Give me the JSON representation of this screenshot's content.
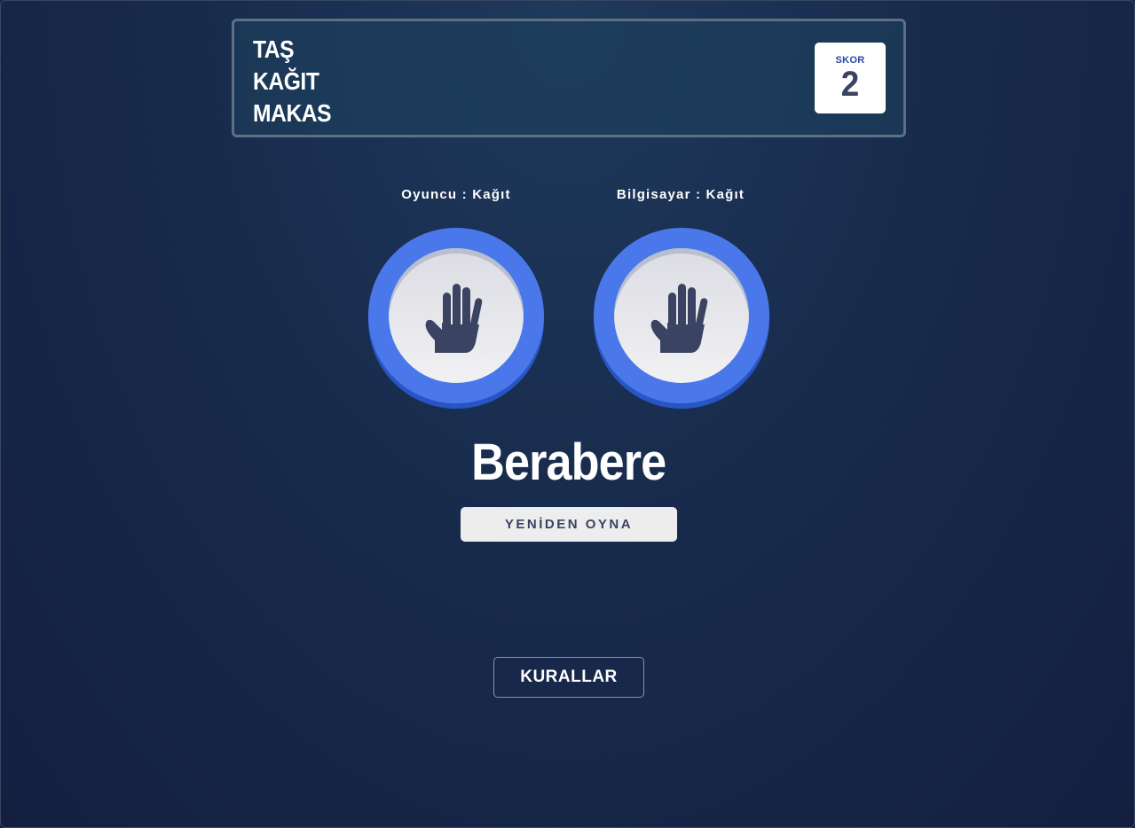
{
  "header": {
    "title_lines": [
      "TAŞ",
      "KAĞIT",
      "MAKAS"
    ],
    "score_label": "SKOR",
    "score_value": "2"
  },
  "game": {
    "player_label": "Oyuncu : Kağıt",
    "computer_label": "Bilgisayar : Kağıt",
    "player_choice_icon": "paper-hand-icon",
    "computer_choice_icon": "paper-hand-icon",
    "result_text": "Berabere",
    "play_again_label": "YENİDEN OYNA"
  },
  "footer": {
    "rules_label": "KURALLAR"
  },
  "colors": {
    "token_ring": "#4a78ea",
    "token_ring_shadow": "#2755c3",
    "icon_color": "#3b4363",
    "score_label_color": "#2a46a8"
  }
}
